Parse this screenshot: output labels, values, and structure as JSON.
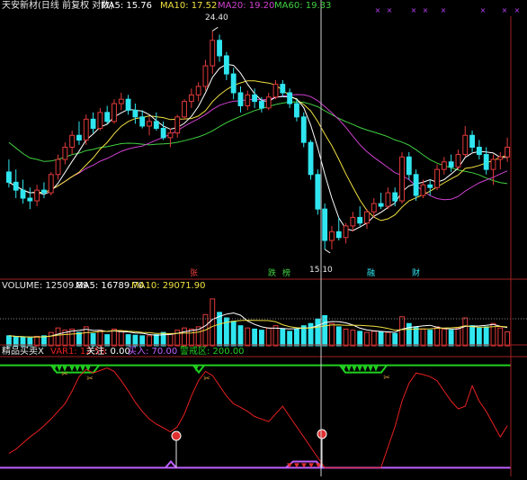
{
  "colors": {
    "up": "#e23a3a",
    "down": "#2fe6f0",
    "ma5": "#ffffff",
    "ma10": "#f0e040",
    "ma20": "#d040d0",
    "ma60": "#40d040",
    "text": "#e8e8e8",
    "marker": "#c040ff",
    "signal": "#e82020",
    "zone": "#20d020",
    "buy": "#c060ff",
    "tag": "#ff4040"
  },
  "price_header": {
    "title": "天安新材(日线 前复权 对数)",
    "ma5_label": "MA5: 15.76",
    "ma10_label": "MA10: 17.52",
    "ma20_label": "MA20: 19.20",
    "ma60_label": "MA60: 19.33"
  },
  "price_notes": {
    "high": "24.40",
    "low": "15.10"
  },
  "price_tags": [
    {
      "text": "张",
      "color": "#ff4040"
    },
    {
      "text": "跌",
      "color": "#40d040"
    },
    {
      "text": "榜",
      "color": "#40d040"
    },
    {
      "text": "融",
      "color": "#2fe6f0"
    },
    {
      "text": "财",
      "color": "#2fe6f0"
    }
  ],
  "volume_header": {
    "title": "VOLUME: 12509.89",
    "ma5_label": "MA5: 16789.70",
    "ma10_label": "MA10: 29071.90"
  },
  "indicator_header": {
    "title": "精品买卖X",
    "var1_label": "VAR1: 12.56",
    "focus_label": "关注: 0.00",
    "buy_label": "买入: 70.00",
    "warn_label": "警戒区: 200.00"
  },
  "icons": [
    "star-marker-icon",
    "arrow-down-icon",
    "sell-flag-icon",
    "buy-balloon-icon"
  ],
  "chart_data": [
    {
      "type": "candlestick",
      "title": "天安新材(日线 前复权 对数)",
      "price_range": [
        14.6,
        25.2
      ],
      "series": [
        {
          "name": "MA5"
        },
        {
          "name": "MA10"
        },
        {
          "name": "MA20"
        },
        {
          "name": "MA60"
        }
      ],
      "annotations": [
        "24.40",
        "15.10"
      ],
      "ohlc": [
        [
          17.9,
          18.4,
          17.3,
          17.5
        ],
        [
          17.5,
          18.0,
          16.9,
          17.2
        ],
        [
          17.2,
          17.6,
          16.7,
          16.9
        ],
        [
          16.9,
          17.3,
          16.5,
          16.8
        ],
        [
          16.8,
          17.4,
          16.6,
          17.2
        ],
        [
          17.2,
          17.5,
          16.9,
          17.1
        ],
        [
          17.1,
          17.9,
          17.0,
          17.8
        ],
        [
          17.8,
          18.6,
          17.6,
          18.4
        ],
        [
          18.4,
          19.1,
          18.2,
          18.9
        ],
        [
          18.9,
          19.6,
          18.6,
          19.4
        ],
        [
          19.4,
          20.0,
          19.0,
          19.2
        ],
        [
          19.2,
          20.3,
          19.0,
          20.1
        ],
        [
          20.1,
          20.4,
          19.5,
          19.7
        ],
        [
          19.7,
          20.6,
          19.6,
          20.4
        ],
        [
          20.4,
          20.7,
          19.9,
          20.0
        ],
        [
          20.0,
          21.0,
          19.9,
          20.8
        ],
        [
          20.8,
          21.3,
          20.5,
          21.0
        ],
        [
          21.0,
          21.2,
          20.3,
          20.5
        ],
        [
          20.5,
          20.8,
          19.9,
          20.2
        ],
        [
          20.2,
          20.5,
          19.7,
          19.8
        ],
        [
          19.8,
          20.2,
          19.4,
          20.0
        ],
        [
          20.0,
          20.4,
          19.6,
          19.7
        ],
        [
          19.7,
          20.0,
          19.2,
          19.3
        ],
        [
          19.3,
          19.7,
          18.9,
          19.5
        ],
        [
          19.5,
          20.3,
          19.3,
          20.2
        ],
        [
          20.2,
          21.0,
          20.1,
          20.9
        ],
        [
          20.9,
          21.5,
          20.6,
          21.2
        ],
        [
          21.2,
          21.8,
          20.9,
          21.6
        ],
        [
          21.6,
          22.9,
          21.4,
          22.6
        ],
        [
          22.6,
          24.4,
          22.2,
          23.9
        ],
        [
          23.9,
          24.2,
          22.8,
          23.1
        ],
        [
          23.1,
          23.3,
          21.9,
          22.2
        ],
        [
          22.2,
          22.5,
          21.0,
          21.3
        ],
        [
          21.3,
          21.6,
          20.4,
          20.7
        ],
        [
          20.7,
          21.4,
          20.5,
          21.2
        ],
        [
          21.2,
          21.5,
          20.6,
          20.9
        ],
        [
          20.9,
          21.1,
          20.4,
          20.6
        ],
        [
          20.6,
          21.3,
          20.5,
          21.1
        ],
        [
          21.1,
          21.9,
          21.0,
          21.7
        ],
        [
          21.7,
          21.9,
          21.1,
          21.3
        ],
        [
          21.3,
          21.5,
          20.6,
          20.8
        ],
        [
          20.8,
          21.0,
          20.0,
          20.2
        ],
        [
          20.2,
          20.4,
          18.9,
          19.1
        ],
        [
          19.1,
          19.2,
          17.6,
          17.8
        ],
        [
          17.8,
          18.0,
          16.3,
          16.5
        ],
        [
          16.5,
          16.7,
          15.1,
          15.4
        ],
        [
          15.4,
          15.9,
          15.1,
          15.7
        ],
        [
          15.7,
          16.2,
          15.4,
          15.5
        ],
        [
          15.5,
          16.0,
          15.3,
          15.9
        ],
        [
          15.9,
          16.4,
          15.7,
          16.2
        ],
        [
          16.2,
          16.6,
          15.9,
          16.0
        ],
        [
          16.0,
          16.5,
          15.8,
          16.4
        ],
        [
          16.4,
          16.9,
          16.2,
          16.7
        ],
        [
          16.7,
          17.1,
          16.5,
          16.6
        ],
        [
          16.6,
          17.3,
          16.5,
          17.1
        ],
        [
          17.1,
          17.3,
          16.6,
          16.8
        ],
        [
          16.8,
          18.7,
          16.7,
          18.5
        ],
        [
          18.5,
          18.7,
          17.6,
          17.8
        ],
        [
          17.8,
          18.0,
          16.8,
          17.0
        ],
        [
          17.0,
          17.6,
          16.9,
          17.4
        ],
        [
          17.4,
          17.6,
          17.0,
          17.3
        ],
        [
          17.3,
          18.2,
          17.2,
          18.0
        ],
        [
          18.0,
          18.5,
          17.8,
          18.3
        ],
        [
          18.3,
          18.6,
          17.9,
          18.1
        ],
        [
          18.1,
          18.8,
          18.0,
          18.6
        ],
        [
          18.6,
          19.8,
          18.5,
          19.4
        ],
        [
          19.4,
          19.6,
          18.7,
          18.9
        ],
        [
          18.9,
          19.2,
          18.4,
          18.6
        ],
        [
          18.6,
          18.9,
          17.8,
          18.0
        ],
        [
          18.0,
          18.6,
          17.4,
          18.4
        ],
        [
          18.4,
          18.7,
          18.0,
          18.5
        ],
        [
          18.5,
          19.3,
          18.3,
          18.9
        ]
      ],
      "volume_range": [
        0,
        50000
      ],
      "volume": [
        9000,
        8000,
        7500,
        7000,
        8500,
        9000,
        12000,
        16000,
        14000,
        15000,
        12000,
        17000,
        11000,
        14000,
        10000,
        15000,
        13000,
        10000,
        9500,
        9000,
        9000,
        10000,
        12000,
        11000,
        14000,
        16000,
        15000,
        17000,
        28000,
        42000,
        30000,
        25000,
        22000,
        18000,
        16000,
        15000,
        14000,
        16000,
        18000,
        15000,
        13000,
        15000,
        18000,
        20000,
        24000,
        27000,
        20000,
        17000,
        15000,
        14000,
        13000,
        12000,
        13000,
        12500,
        12000,
        11000,
        26000,
        20000,
        17000,
        15000,
        14000,
        17000,
        15000,
        14000,
        16000,
        25000,
        18000,
        16000,
        17000,
        20000,
        16000,
        12500
      ],
      "indicator": {
        "name": "VAR1",
        "range": [
          -10,
          210
        ],
        "warn_level": 200,
        "buy_level": 70,
        "focus_level": 0,
        "values": [
          28,
          36,
          48,
          60,
          70,
          82,
          95,
          110,
          125,
          150,
          178,
          192,
          185,
          190,
          195,
          188,
          170,
          150,
          128,
          110,
          95,
          85,
          78,
          70,
          80,
          105,
          140,
          170,
          188,
          180,
          160,
          140,
          125,
          118,
          110,
          100,
          95,
          90,
          105,
          120,
          100,
          80,
          60,
          40,
          20,
          0,
          0,
          0,
          0,
          0,
          0,
          0,
          0,
          0,
          40,
          80,
          130,
          165,
          185,
          182,
          178,
          170,
          150,
          130,
          115,
          120,
          160,
          130,
          110,
          85,
          60,
          82
        ]
      }
    }
  ]
}
